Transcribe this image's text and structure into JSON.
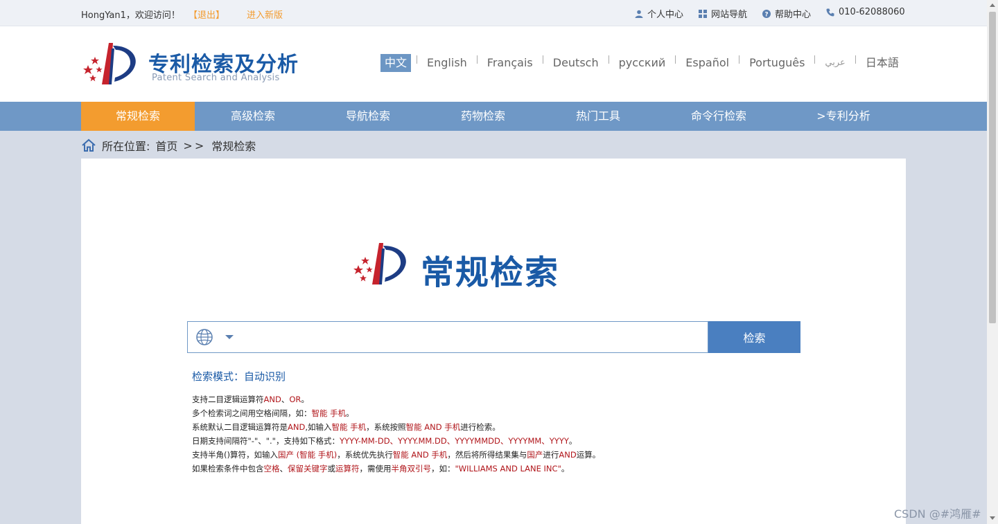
{
  "topbar": {
    "welcome": "HongYan1，欢迎访问！",
    "logout": "【退出】",
    "new_version": "进入新版",
    "links": [
      {
        "label": "个人中心",
        "icon": "user-icon"
      },
      {
        "label": "网站导航",
        "icon": "grid-icon"
      },
      {
        "label": "帮助中心",
        "icon": "help-icon"
      },
      {
        "label": "010-62088060",
        "icon": "phone-icon"
      }
    ]
  },
  "header": {
    "title": "专利检索及分析",
    "subtitle": "Patent Search and Analysis",
    "languages": [
      "中文",
      "English",
      "Français",
      "Deutsch",
      "русский",
      "Español",
      "Português",
      "عربي",
      "日本語"
    ],
    "active_language": "中文"
  },
  "nav": {
    "items": [
      "常规检索",
      "高级检索",
      "导航检索",
      "药物检索",
      "热门工具",
      "命令行检索",
      ">专利分析"
    ],
    "active": "常规检索"
  },
  "breadcrumb": {
    "label": "所在位置:",
    "home": "首页",
    "sep": ">>",
    "current": "常规检索"
  },
  "main": {
    "title": "常规检索",
    "search": {
      "placeholder": "",
      "value": "",
      "button": "检索"
    },
    "mode_label": "检索模式：",
    "mode_value": "自动识别",
    "help": [
      [
        {
          "t": "支持二目逻辑运算符"
        },
        {
          "t": "AND",
          "r": true
        },
        {
          "t": "、"
        },
        {
          "t": "OR",
          "r": true
        },
        {
          "t": "。"
        }
      ],
      [
        {
          "t": "多个检索词之间用空格间隔，如："
        },
        {
          "t": "智能 手机",
          "r": true
        },
        {
          "t": "。"
        }
      ],
      [
        {
          "t": "系统默认二目逻辑运算符是"
        },
        {
          "t": "AND",
          "r": true
        },
        {
          "t": ",如输入"
        },
        {
          "t": "智能 手机",
          "r": true
        },
        {
          "t": "，系统按照"
        },
        {
          "t": "智能 AND 手机",
          "r": true
        },
        {
          "t": "进行检索。"
        }
      ],
      [
        {
          "t": "日期支持间隔符\"-\"、\".\"，支持如下格式："
        },
        {
          "t": "YYYY-MM-DD、YYYY.MM.DD、YYYYMMDD、YYYYMM、YYYY",
          "r": true
        },
        {
          "t": "。"
        }
      ],
      [
        {
          "t": "支持半角()算符，如输入"
        },
        {
          "t": "国产 (智能 手机)",
          "r": true
        },
        {
          "t": "，系统优先执行"
        },
        {
          "t": "智能 AND 手机",
          "r": true
        },
        {
          "t": "，然后将所得结果集与"
        },
        {
          "t": "国产",
          "r": true
        },
        {
          "t": "进行"
        },
        {
          "t": "AND",
          "r": true
        },
        {
          "t": "运算。"
        }
      ],
      [
        {
          "t": "如果检索条件中包含"
        },
        {
          "t": "空格",
          "r": true
        },
        {
          "t": "、"
        },
        {
          "t": "保留关键字",
          "r": true
        },
        {
          "t": "或"
        },
        {
          "t": "运算符",
          "r": true
        },
        {
          "t": "，需使用"
        },
        {
          "t": "半角双引号",
          "r": true
        },
        {
          "t": "，如："
        },
        {
          "t": "\"WILLIAMS AND LANE INC\"",
          "r": true
        },
        {
          "t": "。"
        }
      ]
    ]
  },
  "watermark": "CSDN @#鸿雁#",
  "colors": {
    "brand_blue": "#1a5aa6",
    "nav_blue": "#6f98c6",
    "accent_orange": "#f39c2f",
    "help_red": "#b0151a"
  }
}
